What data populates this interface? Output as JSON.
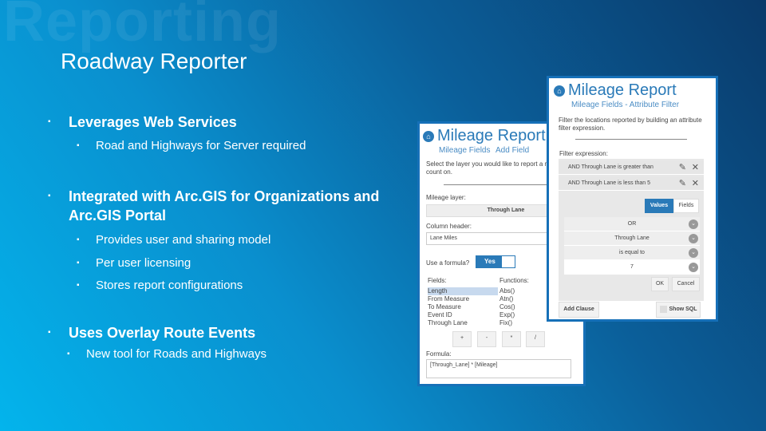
{
  "watermark": "Reporting",
  "title": "Roadway Reporter",
  "bullets": [
    {
      "text": "Leverages Web Services",
      "sub": [
        "Road and Highways for Server required"
      ]
    },
    {
      "text": "Integrated with Arc.GIS for Organizations and Arc.GIS Portal",
      "sub": [
        "Provides user and sharing model",
        "Per user licensing",
        "Stores report configurations"
      ]
    },
    {
      "text": "Uses Overlay Route Events",
      "sub": [
        "New tool for Roads and Highways"
      ]
    }
  ],
  "left_panel": {
    "title": "Mileage Report",
    "tabs": [
      "Mileage Fields",
      "Add Field"
    ],
    "instructions": "Select the layer you would like to report a mileage count on.",
    "layer_label": "Mileage layer:",
    "layer_value": "Through Lane",
    "column_label": "Column header:",
    "column_value": "Lane Miles",
    "formula_q": "Use a formula?",
    "toggle": "Yes",
    "fields_label": "Fields:",
    "functions_label": "Functions:",
    "fields": [
      "Length",
      "From Measure",
      "To Measure",
      "Event ID",
      "Through Lane"
    ],
    "functions": [
      "Abs()",
      "Atn()",
      "Cos()",
      "Exp()",
      "Fix()"
    ],
    "operators": [
      "+",
      "-",
      "*",
      "/"
    ],
    "formula_label": "Formula:",
    "formula_value": "[Through_Lane] * [Mileage]"
  },
  "right_panel": {
    "title": "Mileage Report",
    "subtitle": "Mileage Fields - Attribute Filter",
    "instructions": "Filter the locations reported by building an attribute filter expression.",
    "filter_label": "Filter expression:",
    "clauses": [
      "AND Through Lane is greater than",
      "AND Through Lane is less than 5"
    ],
    "toggle": [
      "Values",
      "Fields"
    ],
    "dropdowns": [
      "OR",
      "Through Lane",
      "is equal to",
      "7"
    ],
    "ok": "OK",
    "cancel": "Cancel",
    "add_clause": "Add Clause",
    "show_sql": "Show SQL"
  }
}
